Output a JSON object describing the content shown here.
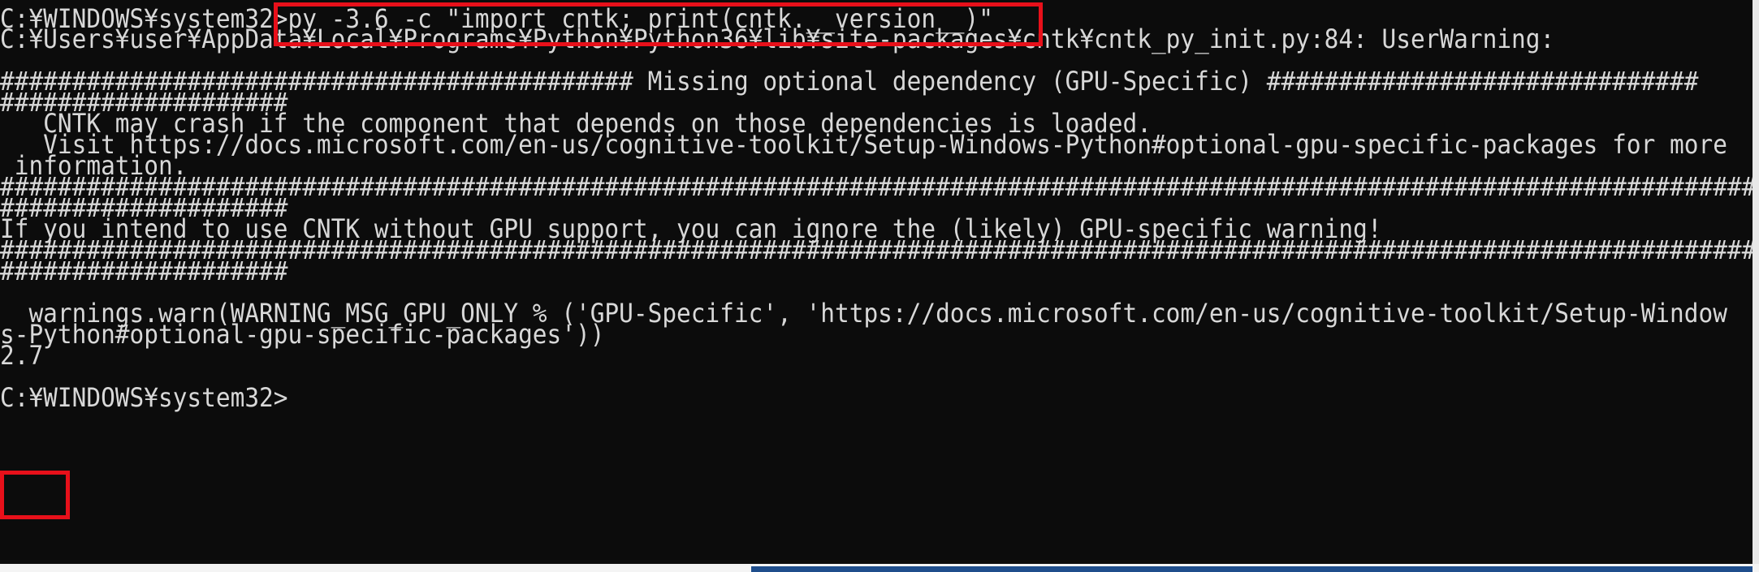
{
  "console": {
    "lines": [
      "C:¥WINDOWS¥system32>py -3.6 -c \"import cntk; print(cntk.__version__)\"",
      "C:¥Users¥user¥AppData¥Local¥Programs¥Python¥Python36¥lib¥site-packages¥cntk¥cntk_py_init.py:84: UserWarning:",
      "",
      "############################################ Missing optional dependency (GPU-Specific) ##############################",
      "####################",
      "   CNTK may crash if the component that depends on those dependencies is loaded.",
      "   Visit https://docs.microsoft.com/en-us/cognitive-toolkit/Setup-Windows-Python#optional-gpu-specific-packages for more",
      " information.",
      "##########################################################################################################################",
      "####################",
      "If you intend to use CNTK without GPU support, you can ignore the (likely) GPU-specific warning!",
      "##########################################################################################################################",
      "####################",
      "",
      "  warnings.warn(WARNING_MSG_GPU_ONLY % ('GPU-Specific', 'https://docs.microsoft.com/en-us/cognitive-toolkit/Setup-Window",
      "s-Python#optional-gpu-specific-packages'))",
      "2.7",
      "",
      "C:¥WINDOWS¥system32>"
    ]
  },
  "colors": {
    "terminal_background": "#0c0c0c",
    "terminal_text": "#d8d8d8",
    "highlight_border": "#e8101a"
  }
}
